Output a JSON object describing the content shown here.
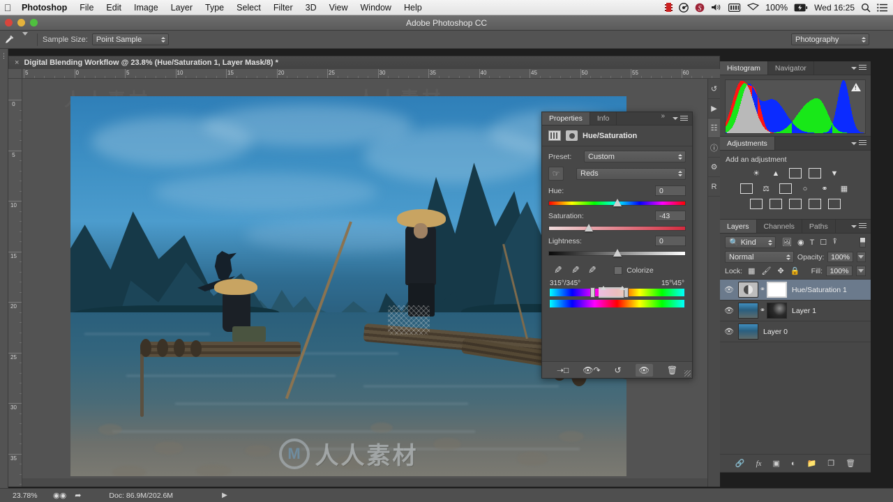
{
  "macbar": {
    "apple": "&#63743;",
    "menus": [
      "Photoshop",
      "File",
      "Edit",
      "Image",
      "Layer",
      "Type",
      "Select",
      "Filter",
      "3D",
      "View",
      "Window",
      "Help"
    ],
    "status_icons": [
      "film-icon",
      "disc-icon",
      "skype-icon",
      "volume-icon",
      "battery-meter-icon",
      "dropbox-icon"
    ],
    "battery_percent": "100%",
    "clock": "Wed 16:25",
    "search_icon": "search-icon",
    "notification_icon": "list-icon"
  },
  "window": {
    "title": "Adobe Photoshop CC"
  },
  "options_bar": {
    "tool_icon": "eyedropper-tool-icon",
    "sample_size_label": "Sample Size:",
    "sample_size_value": "Point Sample",
    "workspace_value": "Photography"
  },
  "document_tab": {
    "close": "×",
    "title": "Digital Blending Workflow @ 23.8% (Hue/Saturation 1, Layer Mask/8) *"
  },
  "rulers": {
    "horizontal": [
      "5",
      "0",
      "5",
      "10",
      "15",
      "20",
      "25",
      "30",
      "35",
      "40",
      "45",
      "50",
      "55",
      "60"
    ],
    "vertical": [
      "0",
      "5",
      "10",
      "15",
      "20",
      "25",
      "30",
      "35"
    ]
  },
  "watermark": {
    "logo": "M",
    "text": "人人素材"
  },
  "properties": {
    "tabs": [
      {
        "label": "Properties",
        "active": true
      },
      {
        "label": "Info",
        "active": false
      }
    ],
    "collapse_icon": "double-chevron-right-icon",
    "title": "Hue/Saturation",
    "preset_label": "Preset:",
    "preset_value": "Custom",
    "channel_value": "Reds",
    "targeted_adjust_icon": "hand-target-icon",
    "sliders": [
      {
        "label": "Hue:",
        "value": "0",
        "knob_pct": 50,
        "kind": "hue"
      },
      {
        "label": "Saturation:",
        "value": "-43",
        "knob_pct": 29,
        "kind": "sat"
      },
      {
        "label": "Lightness:",
        "value": "0",
        "knob_pct": 50,
        "kind": "lig"
      }
    ],
    "eyedroppers": [
      "eyedropper-icon",
      "eyedropper-plus-icon",
      "eyedropper-minus-icon"
    ],
    "colorize_label": "Colorize",
    "colorize_checked": false,
    "range_left": "315°/345°",
    "range_right": "15°\\45°",
    "footer_icons": [
      "clip-to-layer-icon",
      "toggle-previous-icon",
      "reset-icon",
      "visibility-icon",
      "delete-icon"
    ]
  },
  "minidock": {
    "icons": [
      "history-icon",
      "actions-play-icon",
      "layer-comps-icon",
      "info-icon",
      "tool-presets-icon",
      "rpro-icon"
    ]
  },
  "histogram": {
    "tabs": [
      {
        "label": "Histogram",
        "active": true
      },
      {
        "label": "Navigator",
        "active": false
      }
    ],
    "warning_icon": "cached-data-warning-icon"
  },
  "adjustments": {
    "tabs": [
      {
        "label": "Adjustments",
        "active": true
      }
    ],
    "heading": "Add an adjustment",
    "rows": [
      [
        "brightness-contrast-icon",
        "levels-icon",
        "curves-icon",
        "exposure-icon",
        "vibrance-icon"
      ],
      [
        "hue-saturation-icon",
        "color-balance-icon",
        "black-white-icon",
        "photo-filter-icon",
        "channel-mixer-icon",
        "color-lookup-icon"
      ],
      [
        "invert-icon",
        "posterize-icon",
        "threshold-icon",
        "gradient-map-icon",
        "selective-color-icon"
      ]
    ]
  },
  "layers": {
    "tabs": [
      {
        "label": "Layers",
        "active": true
      },
      {
        "label": "Channels",
        "active": false
      },
      {
        "label": "Paths",
        "active": false
      }
    ],
    "filter_kind_value": "Kind",
    "filter_icons": [
      "pixel-filter-icon",
      "adjustment-filter-icon",
      "type-filter-icon",
      "shape-filter-icon",
      "smartobject-filter-icon"
    ],
    "filter_toggle_icon": "filter-toggle-icon",
    "blend_mode": "Normal",
    "opacity_label": "Opacity:",
    "opacity_value": "100%",
    "lock_label": "Lock:",
    "lock_icons": [
      "lock-transparency-icon",
      "lock-image-icon",
      "lock-position-icon",
      "lock-all-icon"
    ],
    "fill_label": "Fill:",
    "fill_value": "100%",
    "items": [
      {
        "name": "Hue/Saturation 1",
        "selected": true,
        "thumb": "adjustment",
        "mask": "white",
        "linked": true
      },
      {
        "name": "Layer 1",
        "selected": false,
        "thumb": "photo",
        "mask": "dark",
        "linked": true
      },
      {
        "name": "Layer 0",
        "selected": false,
        "thumb": "photo",
        "mask": "none",
        "linked": false
      }
    ],
    "footer_icons": [
      "link-layers-icon",
      "layer-style-fx-icon",
      "add-mask-icon",
      "new-adjustment-icon",
      "new-group-icon",
      "new-layer-icon",
      "delete-layer-icon"
    ]
  },
  "statusbar": {
    "zoom": "23.78%",
    "icons": [
      "camera-raw-icon",
      "share-icon"
    ],
    "doc_info": "Doc: 86.9M/202.6M",
    "play_icon": "play-arrow-icon"
  }
}
